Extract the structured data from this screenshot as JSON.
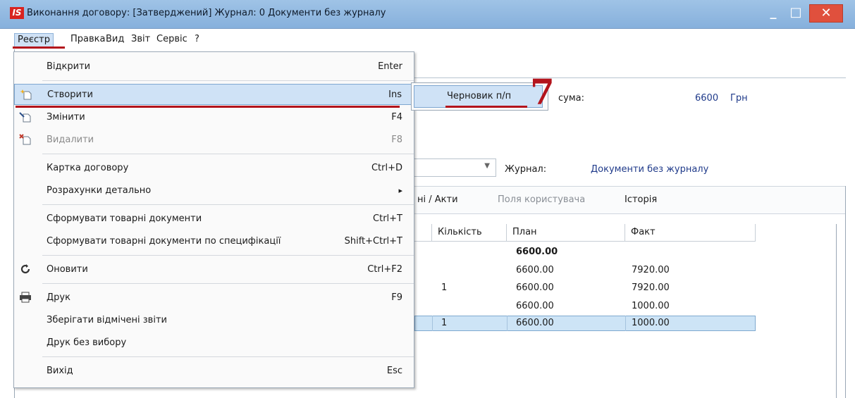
{
  "window": {
    "logo": "IS",
    "title": "Виконання договору: [Затверджений] Журнал: 0 Документи без журналу",
    "min_glyph": "_",
    "max_glyph": "□",
    "close_glyph": "✕"
  },
  "menubar": [
    "Реєстр",
    "Правка",
    "Вид",
    "Звіт",
    "Сервіс",
    "?"
  ],
  "dropdown": {
    "items": [
      {
        "label": "Відкрити",
        "shortcut": "Enter",
        "icon": ""
      },
      {
        "label": "Створити",
        "shortcut": "Ins",
        "icon": "new-doc-icon"
      },
      {
        "label": "Змінити",
        "shortcut": "F4",
        "icon": "edit-doc-icon"
      },
      {
        "label": "Видалити",
        "shortcut": "F8",
        "icon": "delete-doc-icon"
      },
      {
        "label": "Картка договору",
        "shortcut": "Ctrl+D"
      },
      {
        "label": "Розрахунки детально",
        "shortcut": "▸"
      },
      {
        "label": "Сформувати товарні документи",
        "shortcut": "Ctrl+T"
      },
      {
        "label": "Сформувати товарні документи по специфікації",
        "shortcut": "Shift+Ctrl+T"
      },
      {
        "label": "Оновити",
        "shortcut": "Ctrl+F2",
        "icon": "refresh-icon"
      },
      {
        "label": "Друк",
        "shortcut": "F9",
        "icon": "printer-icon"
      },
      {
        "label": "Зберігати відмічені звіти",
        "shortcut": ""
      },
      {
        "label": "Друк без вибору",
        "shortcut": ""
      },
      {
        "label": "Вихід",
        "shortcut": "Esc"
      }
    ]
  },
  "submenu": {
    "item": "Черновик п/п"
  },
  "step_marker": "7",
  "background": {
    "sum_label": "сума:",
    "sum_value": "6600",
    "currency": "Грн",
    "journal_label": "Журнал:",
    "journal_value": "Документи без журналу",
    "tabs": [
      "ні / Акти",
      "Поля користувача",
      "Історія"
    ],
    "columns": [
      "Кількість",
      "План",
      "Факт"
    ],
    "rows": [
      {
        "qty": "",
        "plan": "6600.00",
        "fact": ""
      },
      {
        "qty": "",
        "plan": "6600.00",
        "fact": "7920.00"
      },
      {
        "qty": "1",
        "plan": "6600.00",
        "fact": "7920.00"
      },
      {
        "qty": "",
        "plan": "6600.00",
        "fact": "1000.00"
      },
      {
        "qty": "1",
        "plan": "6600.00",
        "fact": "1000.00"
      }
    ]
  },
  "colors": {
    "accent_red": "#b3141c",
    "highlight": "#cfe2f6",
    "title_bar": "#9fc3e6"
  }
}
